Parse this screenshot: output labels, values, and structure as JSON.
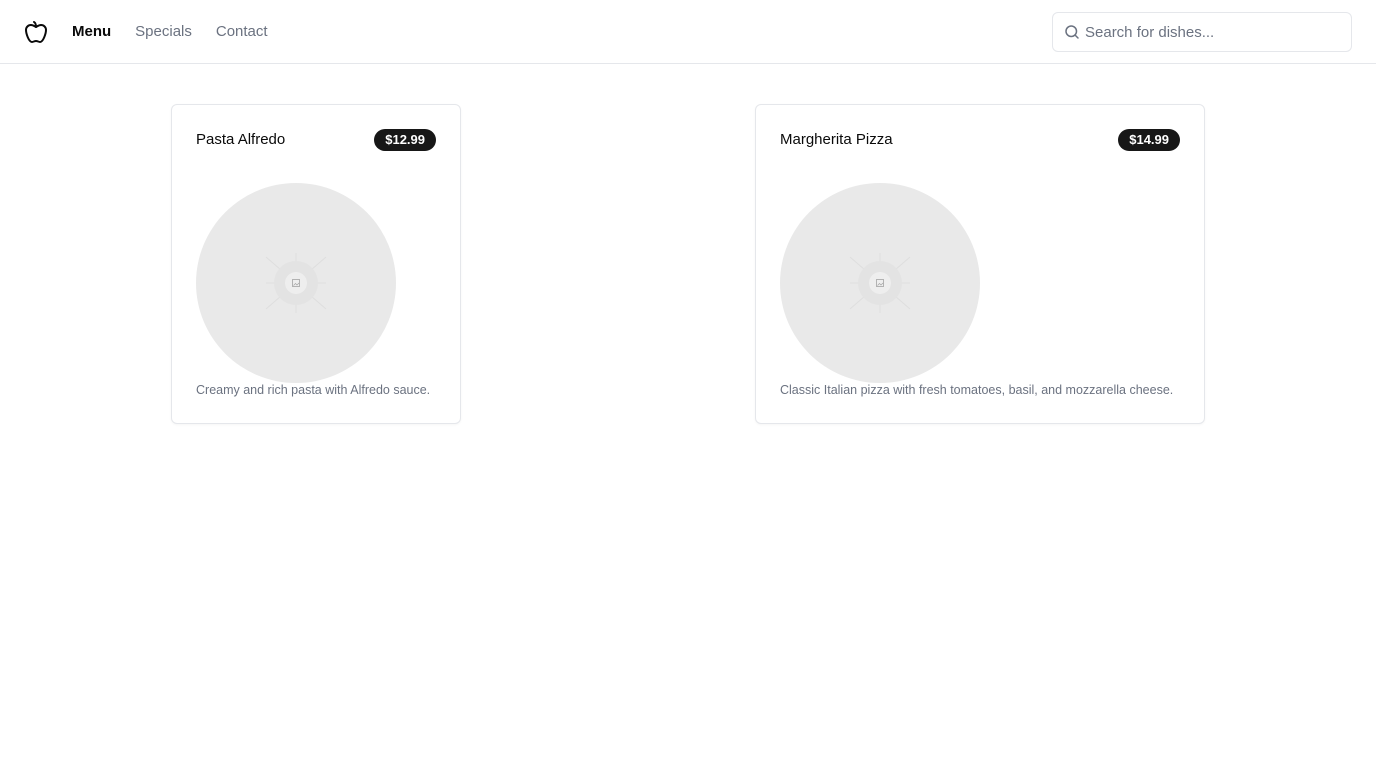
{
  "header": {
    "logo_icon": "apple-icon",
    "nav": [
      {
        "label": "Menu",
        "active": true
      },
      {
        "label": "Specials",
        "active": false
      },
      {
        "label": "Contact",
        "active": false
      }
    ],
    "search": {
      "icon": "search-icon",
      "placeholder": "Search for dishes...",
      "value": ""
    }
  },
  "dishes": [
    {
      "name": "Pasta Alfredo",
      "price": "$12.99",
      "image_icon": "image-placeholder-icon",
      "description": "Creamy and rich pasta with Alfredo sauce."
    },
    {
      "name": "Margherita Pizza",
      "price": "$14.99",
      "image_icon": "image-placeholder-icon",
      "description": "Classic Italian pizza with fresh tomatoes, basil, and mozzarella cheese."
    }
  ],
  "colors": {
    "text": "#0a0a0a",
    "muted": "#6b7280",
    "border": "#e5e7eb",
    "badge_bg": "#171717",
    "image_bg": "#e9e9e9"
  }
}
